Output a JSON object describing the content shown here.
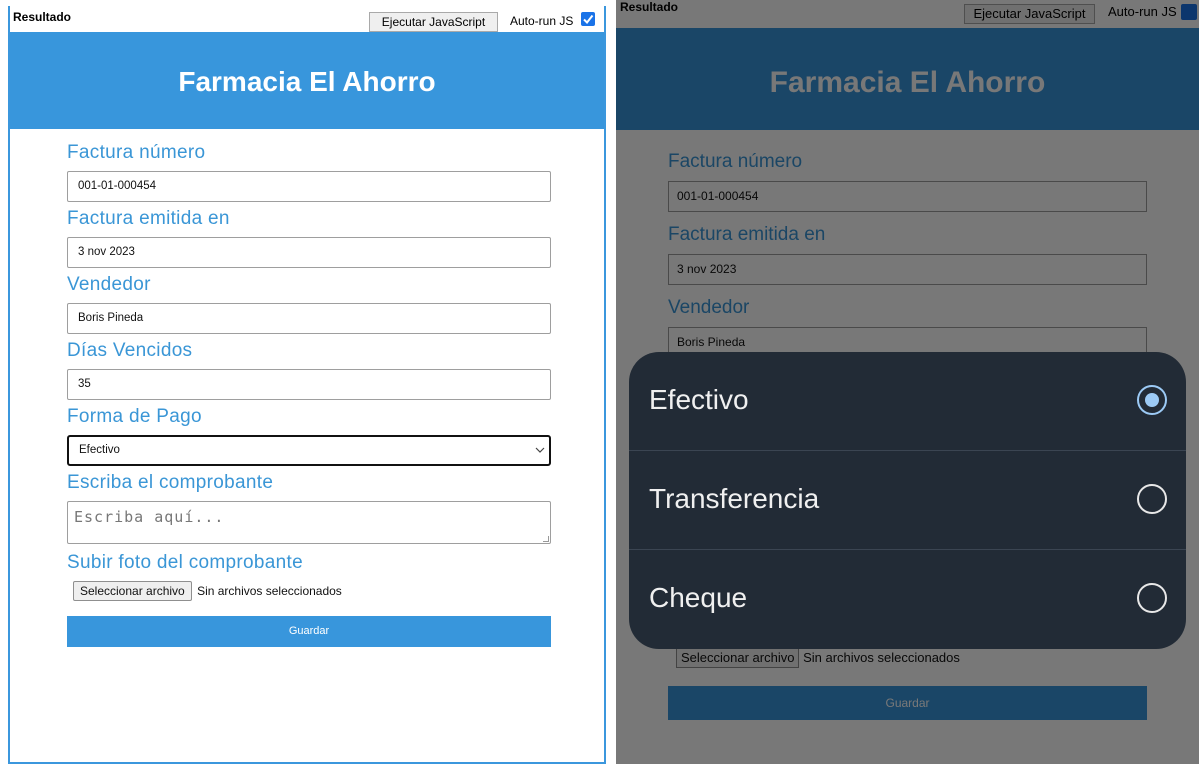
{
  "toolbar": {
    "result_label": "Resultado",
    "run_button": "Ejecutar JavaScript",
    "autorun_label": "Auto-run JS",
    "autorun_checked": true
  },
  "header": {
    "title": "Farmacia El Ahorro"
  },
  "form": {
    "invoice_number_label": "Factura número",
    "invoice_number_value": "001-01-000454",
    "issued_label": "Factura emitida en",
    "issued_value": "3 nov 2023",
    "seller_label": "Vendedor",
    "seller_value": "Boris Pineda",
    "overdue_label": "Días Vencidos",
    "overdue_value": "35",
    "payment_label": "Forma de Pago",
    "payment_value": "Efectivo",
    "receipt_label": "Escriba el comprobante",
    "receipt_placeholder": "Escriba aquí...",
    "photo_label": "Subir foto del comprobante",
    "file_button": "Seleccionar archivo",
    "file_status": "Sin archivos seleccionados",
    "save_button": "Guardar"
  },
  "payment_sheet": {
    "options": [
      {
        "label": "Efectivo",
        "selected": true
      },
      {
        "label": "Transferencia",
        "selected": false
      },
      {
        "label": "Cheque",
        "selected": false
      }
    ]
  },
  "colors": {
    "accent": "#3896dc",
    "sheet_bg": "#222b36",
    "radio_selected": "#9ccaf5"
  }
}
